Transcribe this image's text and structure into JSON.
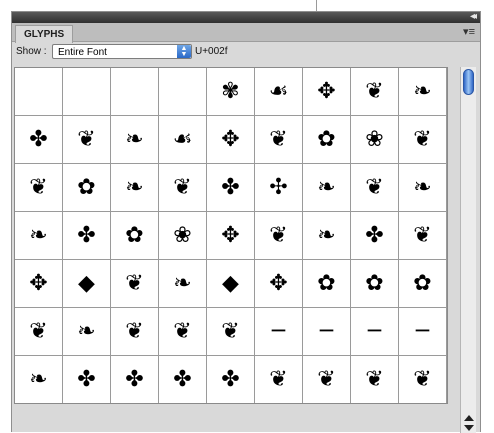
{
  "panel": {
    "tab_label": "GLYPHS",
    "show_label": "Show :",
    "show_value": "Entire Font",
    "unicode": "U+002f",
    "collapse_glyph": "◂◂",
    "menu_glyph": "▾≡"
  },
  "glyphs": [
    [
      "",
      "",
      "",
      "",
      "✾",
      "☙",
      "✥",
      "❦",
      "❧"
    ],
    [
      "✤",
      "❦",
      "❧",
      "☙",
      "✥",
      "❦",
      "✿",
      "❀",
      "❦"
    ],
    [
      "❦",
      "✿",
      "❧",
      "❦",
      "✤",
      "✣",
      "❧",
      "❦",
      "❧"
    ],
    [
      "❧",
      "✤",
      "✿",
      "❀",
      "✥",
      "❦",
      "❧",
      "✤",
      "❦"
    ],
    [
      "✥",
      "◆",
      "❦",
      "❧",
      "◆",
      "✥",
      "✿",
      "✿",
      "✿"
    ],
    [
      "❦",
      "❧",
      "❦",
      "❦",
      "❦",
      "─",
      "─",
      "─",
      "─"
    ],
    [
      "❧",
      "✤",
      "✤",
      "✤",
      "✤",
      "❦",
      "❦",
      "❦",
      "❦"
    ]
  ],
  "colors": {
    "accent": "#2f66c6",
    "panel_bg": "#d9d9d9",
    "grid_bg": "#ffffff"
  }
}
